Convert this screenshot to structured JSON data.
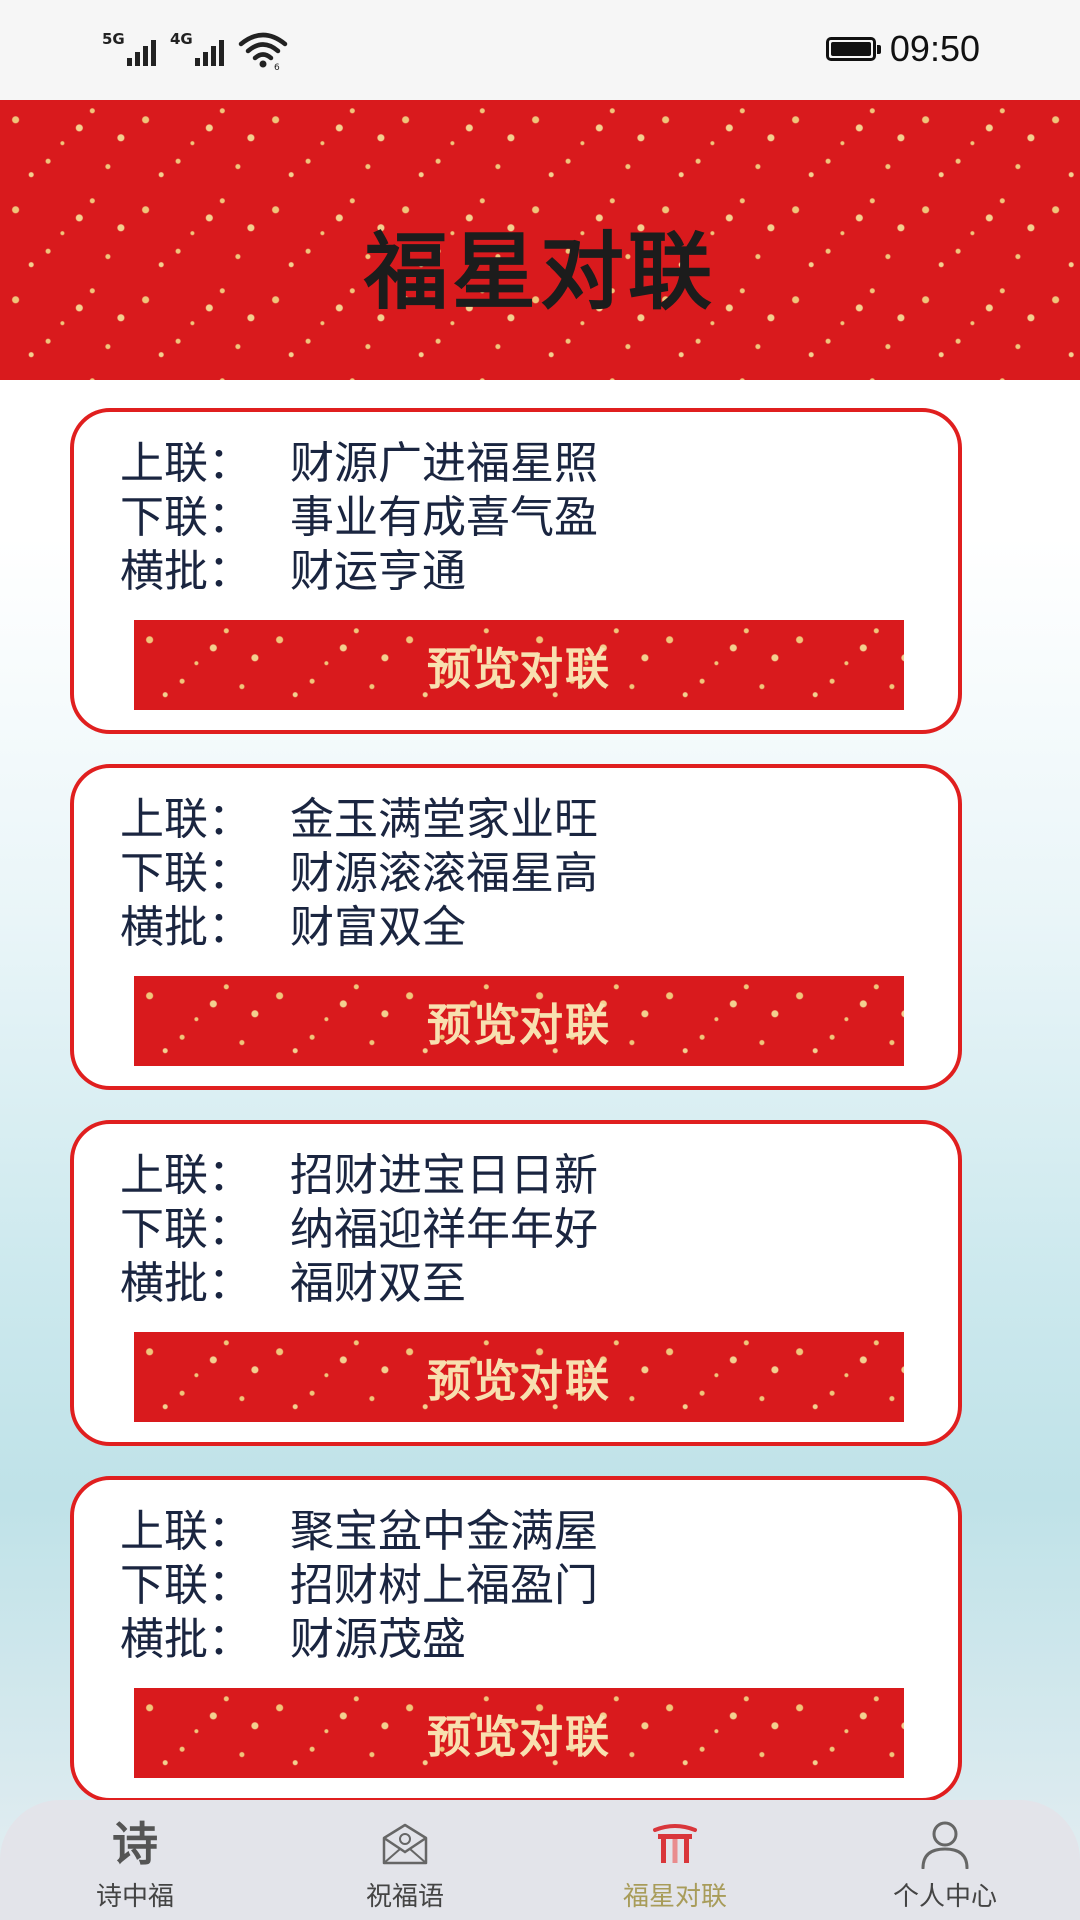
{
  "status_bar": {
    "signal_1": "5G",
    "signal_2": "4G",
    "time": "09:50"
  },
  "header": {
    "title": "福星对联"
  },
  "colors": {
    "accent_red": "#d91a1d",
    "card_border": "#e01f1f",
    "button_text_gold": "#f8e0b0",
    "active_tab": "#a89c5a"
  },
  "couplets": [
    {
      "upper_key": "上联：",
      "upper": "财源广进福星照",
      "lower_key": "下联：",
      "lower": "事业有成喜气盈",
      "horizontal_key": "横批：",
      "horizontal": "财运亨通",
      "button_label": "预览对联"
    },
    {
      "upper_key": "上联：",
      "upper": "金玉满堂家业旺",
      "lower_key": "下联：",
      "lower": "财源滚滚福星高",
      "horizontal_key": "横批：",
      "horizontal": "财富双全",
      "button_label": "预览对联"
    },
    {
      "upper_key": "上联：",
      "upper": "招财进宝日日新",
      "lower_key": "下联：",
      "lower": "纳福迎祥年年好",
      "horizontal_key": "横批：",
      "horizontal": "福财双至",
      "button_label": "预览对联"
    },
    {
      "upper_key": "上联：",
      "upper": "聚宝盆中金满屋",
      "lower_key": "下联：",
      "lower": "招财树上福盈门",
      "horizontal_key": "横批：",
      "horizontal": "财源茂盛",
      "button_label": "预览对联"
    }
  ],
  "bottom_nav": {
    "items": [
      {
        "label": "诗中福",
        "icon": "poem-icon",
        "glyph": "诗",
        "active": false
      },
      {
        "label": "祝福语",
        "icon": "envelope-icon",
        "active": false
      },
      {
        "label": "福星对联",
        "icon": "gate-icon",
        "active": true
      },
      {
        "label": "个人中心",
        "icon": "person-icon",
        "active": false
      }
    ]
  }
}
